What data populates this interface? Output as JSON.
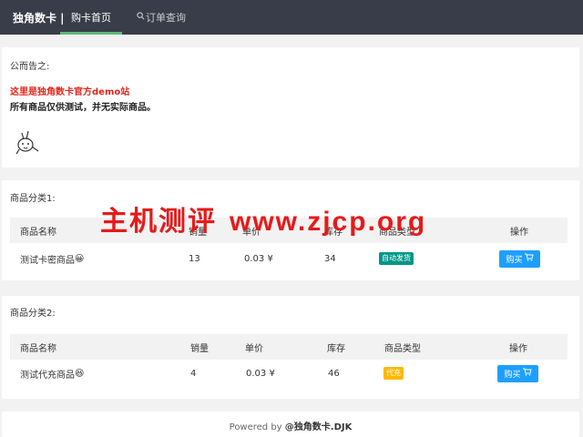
{
  "nav": {
    "brand": "独角数卡 |",
    "home_label": "购卡首页",
    "order_label": "订单查询"
  },
  "notice": {
    "title": "公而告之:",
    "line_red": "这里是独角数卡官方demo站",
    "line_black": "所有商品仅供测试，并无实际商品。"
  },
  "categories": [
    {
      "title": "商品分类1:",
      "headers": [
        "商品名称",
        "销量",
        "单价",
        "库存",
        "商品类型",
        "操作"
      ],
      "rows": [
        {
          "name": "测试卡密商品",
          "emoji": "😀",
          "sales": "13",
          "price": "0.03 ¥",
          "stock": "34",
          "type": "自动发货",
          "action": "购买"
        }
      ]
    },
    {
      "title": "商品分类2:",
      "headers": [
        "商品名称",
        "销量",
        "单价",
        "库存",
        "商品类型",
        "操作"
      ],
      "rows": [
        {
          "name": "测试代充商品",
          "emoji": "😆",
          "sales": "4",
          "price": "0.03 ¥",
          "stock": "46",
          "type": "代充",
          "action": "购买"
        }
      ]
    }
  ],
  "footer": {
    "prefix": "Powered by ",
    "brand": "@独角数卡.DJK"
  },
  "watermark": {
    "zh": "主机测评",
    "url": "www.zjcp.org"
  },
  "colors": {
    "nav_bg": "#393d49",
    "nav_active": "#5fb878",
    "notice_red": "#e1261c",
    "badge_auto": "#009688",
    "badge_charge": "#ffb800",
    "buy_button": "#1e9fff",
    "watermark": "#e61a1a"
  }
}
